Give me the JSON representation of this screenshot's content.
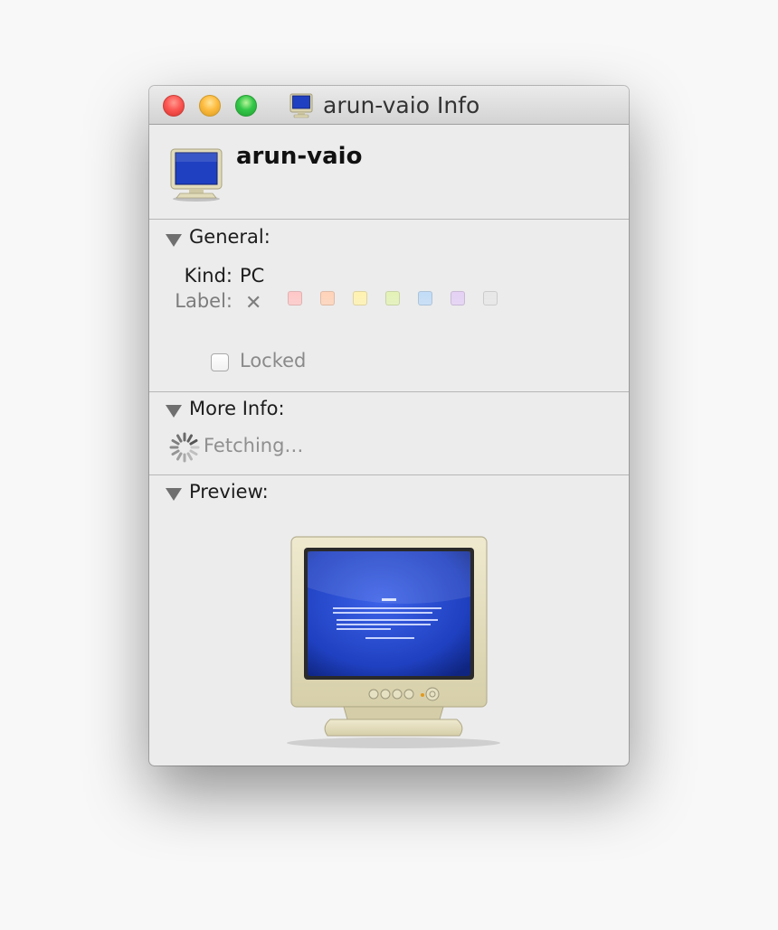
{
  "window": {
    "title": "arun-vaio Info"
  },
  "header": {
    "name": "arun-vaio",
    "icon": "computer-monitor-icon"
  },
  "general": {
    "title": "General:",
    "kind_label": "Kind:",
    "kind_value": "PC",
    "label_label": "Label:",
    "label_none_glyph": "✕",
    "label_colors": [
      "#ffc7c7",
      "#ffd2b8",
      "#fff2b0",
      "#e3f2b6",
      "#c1dcf7",
      "#e4d0f4",
      "#e7e7e7"
    ],
    "locked_label": "Locked",
    "locked_checked": false
  },
  "more_info": {
    "title": "More Info:",
    "status": "Fetching…",
    "icon": "spinner-icon"
  },
  "preview": {
    "title": "Preview:",
    "icon": "computer-monitor-icon"
  },
  "colors": {
    "close": "#fc5753",
    "minimize": "#fdbc40",
    "zoom": "#33c748",
    "screen_blue": "#1f40c0"
  }
}
